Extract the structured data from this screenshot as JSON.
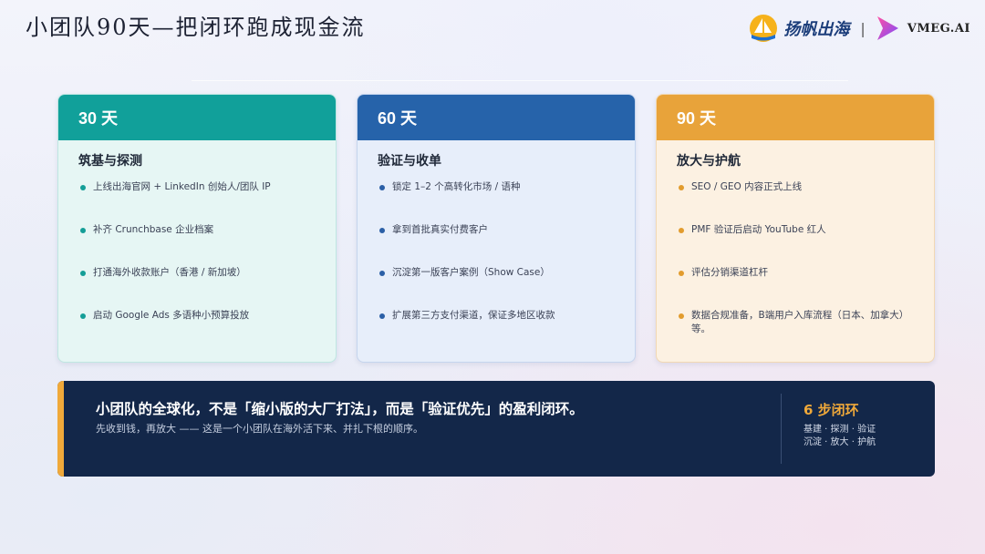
{
  "slide": {
    "title": "小团队90天—把闭环跑成现金流"
  },
  "logos": {
    "brand1": "扬帆出海",
    "separator": "|",
    "brand2": "VMEG.AI"
  },
  "cards": [
    {
      "period": "30 天",
      "heading": "筑基与探测",
      "items": [
        "上线出海官网 + LinkedIn 创始人/团队 IP",
        "补齐 Crunchbase 企业档案",
        "打通海外收款账户（香港 / 新加坡）",
        "启动 Google Ads 多语种小预算投放"
      ]
    },
    {
      "period": "60 天",
      "heading": "验证与收单",
      "items": [
        "锁定 1–2 个高转化市场 / 语种",
        "拿到首批真实付费客户",
        "沉淀第一版客户案例（Show Case）",
        "扩展第三方支付渠道，保证多地区收款"
      ]
    },
    {
      "period": "90 天",
      "heading": "放大与护航",
      "items": [
        "SEO / GEO 内容正式上线",
        "PMF 验证后启动 YouTube 红人",
        "评估分销渠道杠杆",
        "数据合规准备，B端用户入库流程（日本、加拿大）等。"
      ]
    }
  ],
  "banner": {
    "headline": "小团队的全球化，不是「缩小版的大厂打法」，而是「验证优先」的盈利闭环。",
    "subline": "先收到钱，再放大 —— 这是一个小团队在海外活下来、并扎下根的顺序。",
    "steps_title": "6 步闭环",
    "steps_line1": "基建 · 探测 · 验证",
    "steps_line2": "沉淀 · 放大 · 护航"
  },
  "colors": {
    "card1_header": "#11a09a",
    "card2_header": "#2663aa",
    "card3_header": "#e8a33a",
    "banner_bg": "#132749",
    "accent": "#f0a93a"
  },
  "icons": [
    "sail-logo-icon",
    "vmeg-play-logo-icon",
    "bullet-dot-icon"
  ]
}
